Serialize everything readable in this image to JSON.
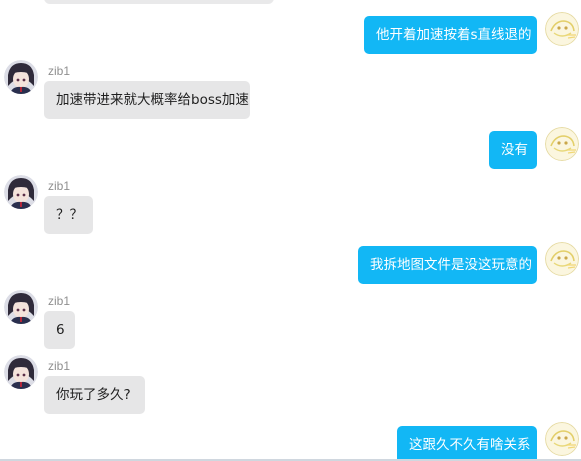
{
  "chat": {
    "messages": [
      {
        "side": "out",
        "text": "他开着加速按着s直线退的"
      },
      {
        "side": "in",
        "sender": "zib1",
        "text": "加速带进来就大概率给boss加速"
      },
      {
        "side": "out",
        "text": "没有"
      },
      {
        "side": "in",
        "sender": "zib1",
        "text": "？？"
      },
      {
        "side": "out",
        "text": "我拆地图文件是没这玩意的"
      },
      {
        "side": "in",
        "sender": "zib1",
        "text": "6"
      },
      {
        "side": "in",
        "sender": "zib1",
        "text": "你玩了多久?"
      },
      {
        "side": "out",
        "text": "这跟久不久有啥关系"
      }
    ]
  },
  "colors": {
    "outgoing_bubble": "#12b7f5",
    "incoming_bubble": "#e6e6e7",
    "sender_name": "#8f8f8f"
  },
  "icons": {
    "incoming_avatar": "anime-character-avatar-icon",
    "outgoing_avatar": "yellow-sketch-avatar-icon"
  }
}
